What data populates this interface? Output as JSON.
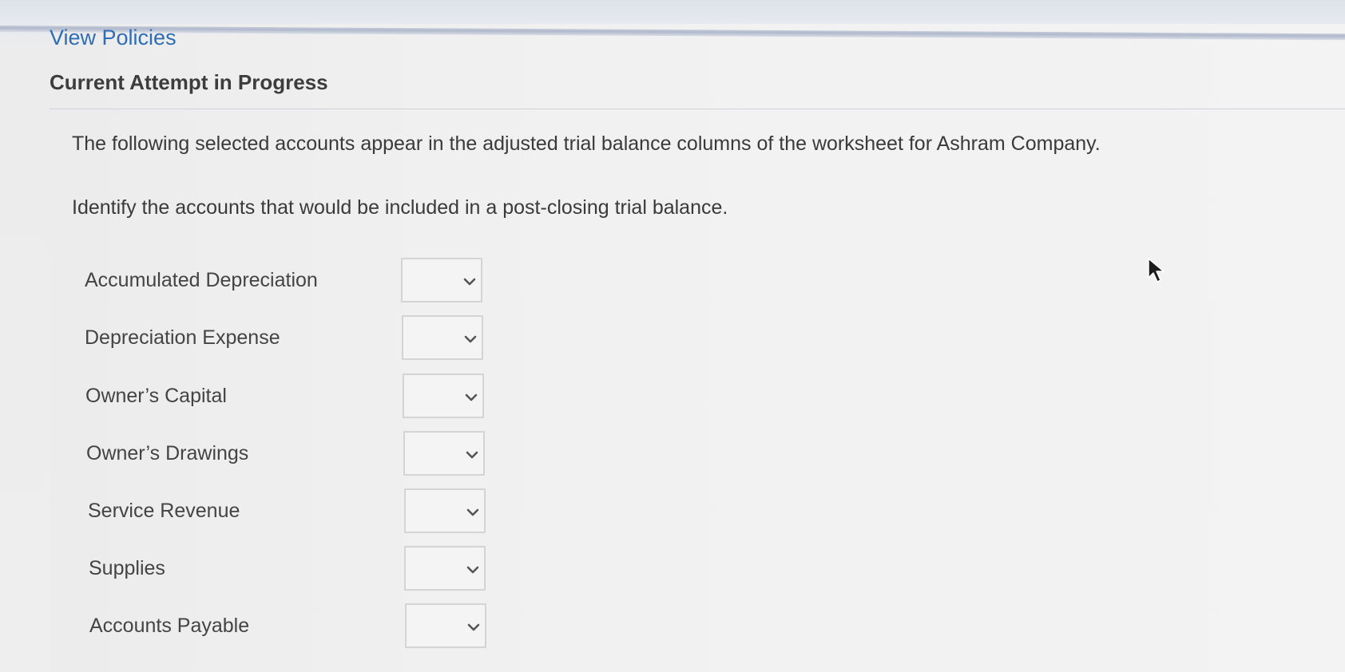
{
  "header": {
    "view_policies_link": "View Policies",
    "attempt_title": "Current Attempt in Progress"
  },
  "question": {
    "intro": "The following selected accounts appear in the adjusted trial balance columns of the worksheet for Ashram Company.",
    "instruction": "Identify the accounts that would be included in a post-closing trial balance."
  },
  "accounts": [
    {
      "label": "Accumulated Depreciation",
      "selected": ""
    },
    {
      "label": "Depreciation Expense",
      "selected": ""
    },
    {
      "label": "Owner’s Capital",
      "selected": ""
    },
    {
      "label": "Owner’s Drawings",
      "selected": ""
    },
    {
      "label": "Service Revenue",
      "selected": ""
    },
    {
      "label": "Supplies",
      "selected": ""
    },
    {
      "label": "Accounts Payable",
      "selected": ""
    }
  ],
  "colors": {
    "link": "#2e6db4",
    "text": "#3a3a3a",
    "dropdown_border": "#d2d4d6"
  },
  "icons": {
    "dropdown": "chevron-down-icon",
    "pointer": "mouse-cursor-icon"
  }
}
